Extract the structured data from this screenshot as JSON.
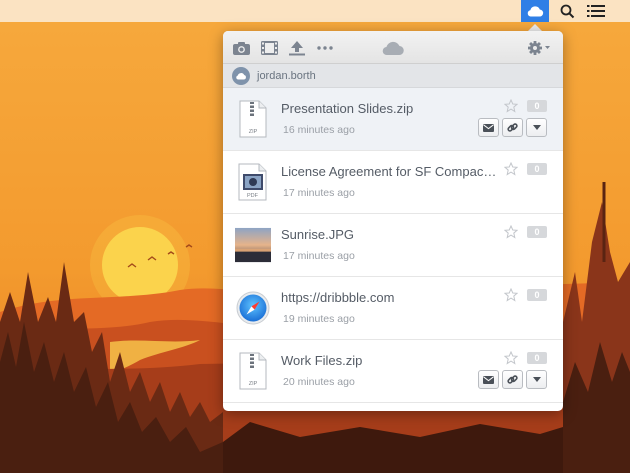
{
  "menubar": {
    "icons": [
      "cloud-icon",
      "search-icon",
      "list-icon"
    ],
    "active_color": "#2f7fe6"
  },
  "toolbar": {
    "icons": [
      "camera-icon",
      "video-icon",
      "upload-icon",
      "more-icon",
      "cloud-icon",
      "gear-icon"
    ]
  },
  "account": {
    "username": "jordan.borth"
  },
  "files": [
    {
      "name": "Presentation Slides.zip",
      "time": "16 minutes ago",
      "count": "0",
      "type": "zip",
      "selected": true,
      "show_actions": true
    },
    {
      "name": "License Agreement for SF Compact F...",
      "time": "17 minutes ago",
      "count": "0",
      "type": "pdf",
      "selected": false,
      "show_actions": false
    },
    {
      "name": "Sunrise.JPG",
      "time": "17 minutes ago",
      "count": "0",
      "type": "image",
      "selected": false,
      "show_actions": false
    },
    {
      "name": "https://dribbble.com",
      "time": "19 minutes ago",
      "count": "0",
      "type": "link",
      "selected": false,
      "show_actions": false
    },
    {
      "name": "Work Files.zip",
      "time": "20 minutes ago",
      "count": "0",
      "type": "zip",
      "selected": false,
      "show_actions": true
    }
  ],
  "file_type_labels": {
    "zip": "ZIP",
    "pdf": "PDF"
  },
  "colors": {
    "accent": "#2f7fe6",
    "wallpaper_sky": "#f4a13a",
    "wallpaper_dark": "#4a1f10"
  }
}
